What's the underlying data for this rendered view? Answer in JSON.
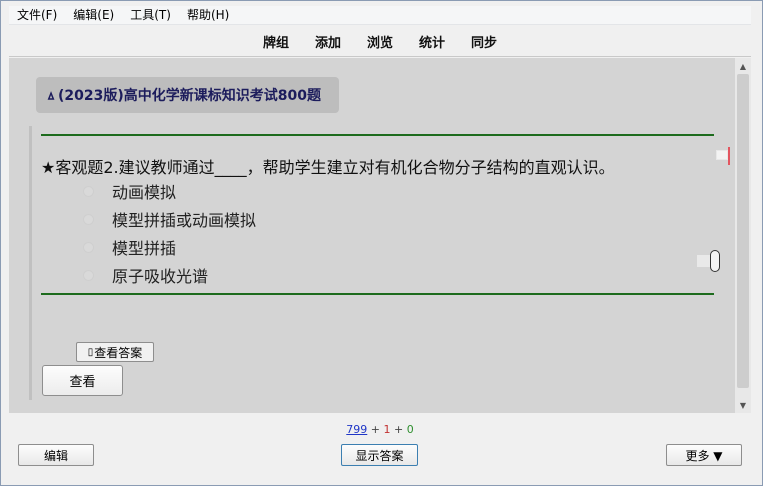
{
  "menubar": {
    "items": [
      "文件(F)",
      "编辑(E)",
      "工具(T)",
      "帮助(H)"
    ]
  },
  "toolbar": {
    "links": [
      "牌组",
      "添加",
      "浏览",
      "统计",
      "同步"
    ]
  },
  "deck": {
    "icon": "🜂",
    "title": "(2023版)高中化学新课标知识考试800题"
  },
  "card": {
    "question": "★客观题2.建议教师通过____，帮助学生建立对有机化合物分子结构的直观认识。",
    "options": [
      "动画模拟",
      "模型拼插或动画模拟",
      "模型拼插",
      "原子吸收光谱"
    ],
    "show_answer_small": "查看答案",
    "view_button": "查看"
  },
  "counts": {
    "new": "799",
    "plus1": "+",
    "learn": "1",
    "plus2": "+",
    "due": "0"
  },
  "bottombar": {
    "edit": "编辑",
    "show_answer": "显示答案",
    "more": "更多 ▼"
  },
  "colors": {
    "rule": "#1d6b1d",
    "new": "#1f36c7",
    "learn": "#c23131",
    "due": "#2f8f2f"
  }
}
